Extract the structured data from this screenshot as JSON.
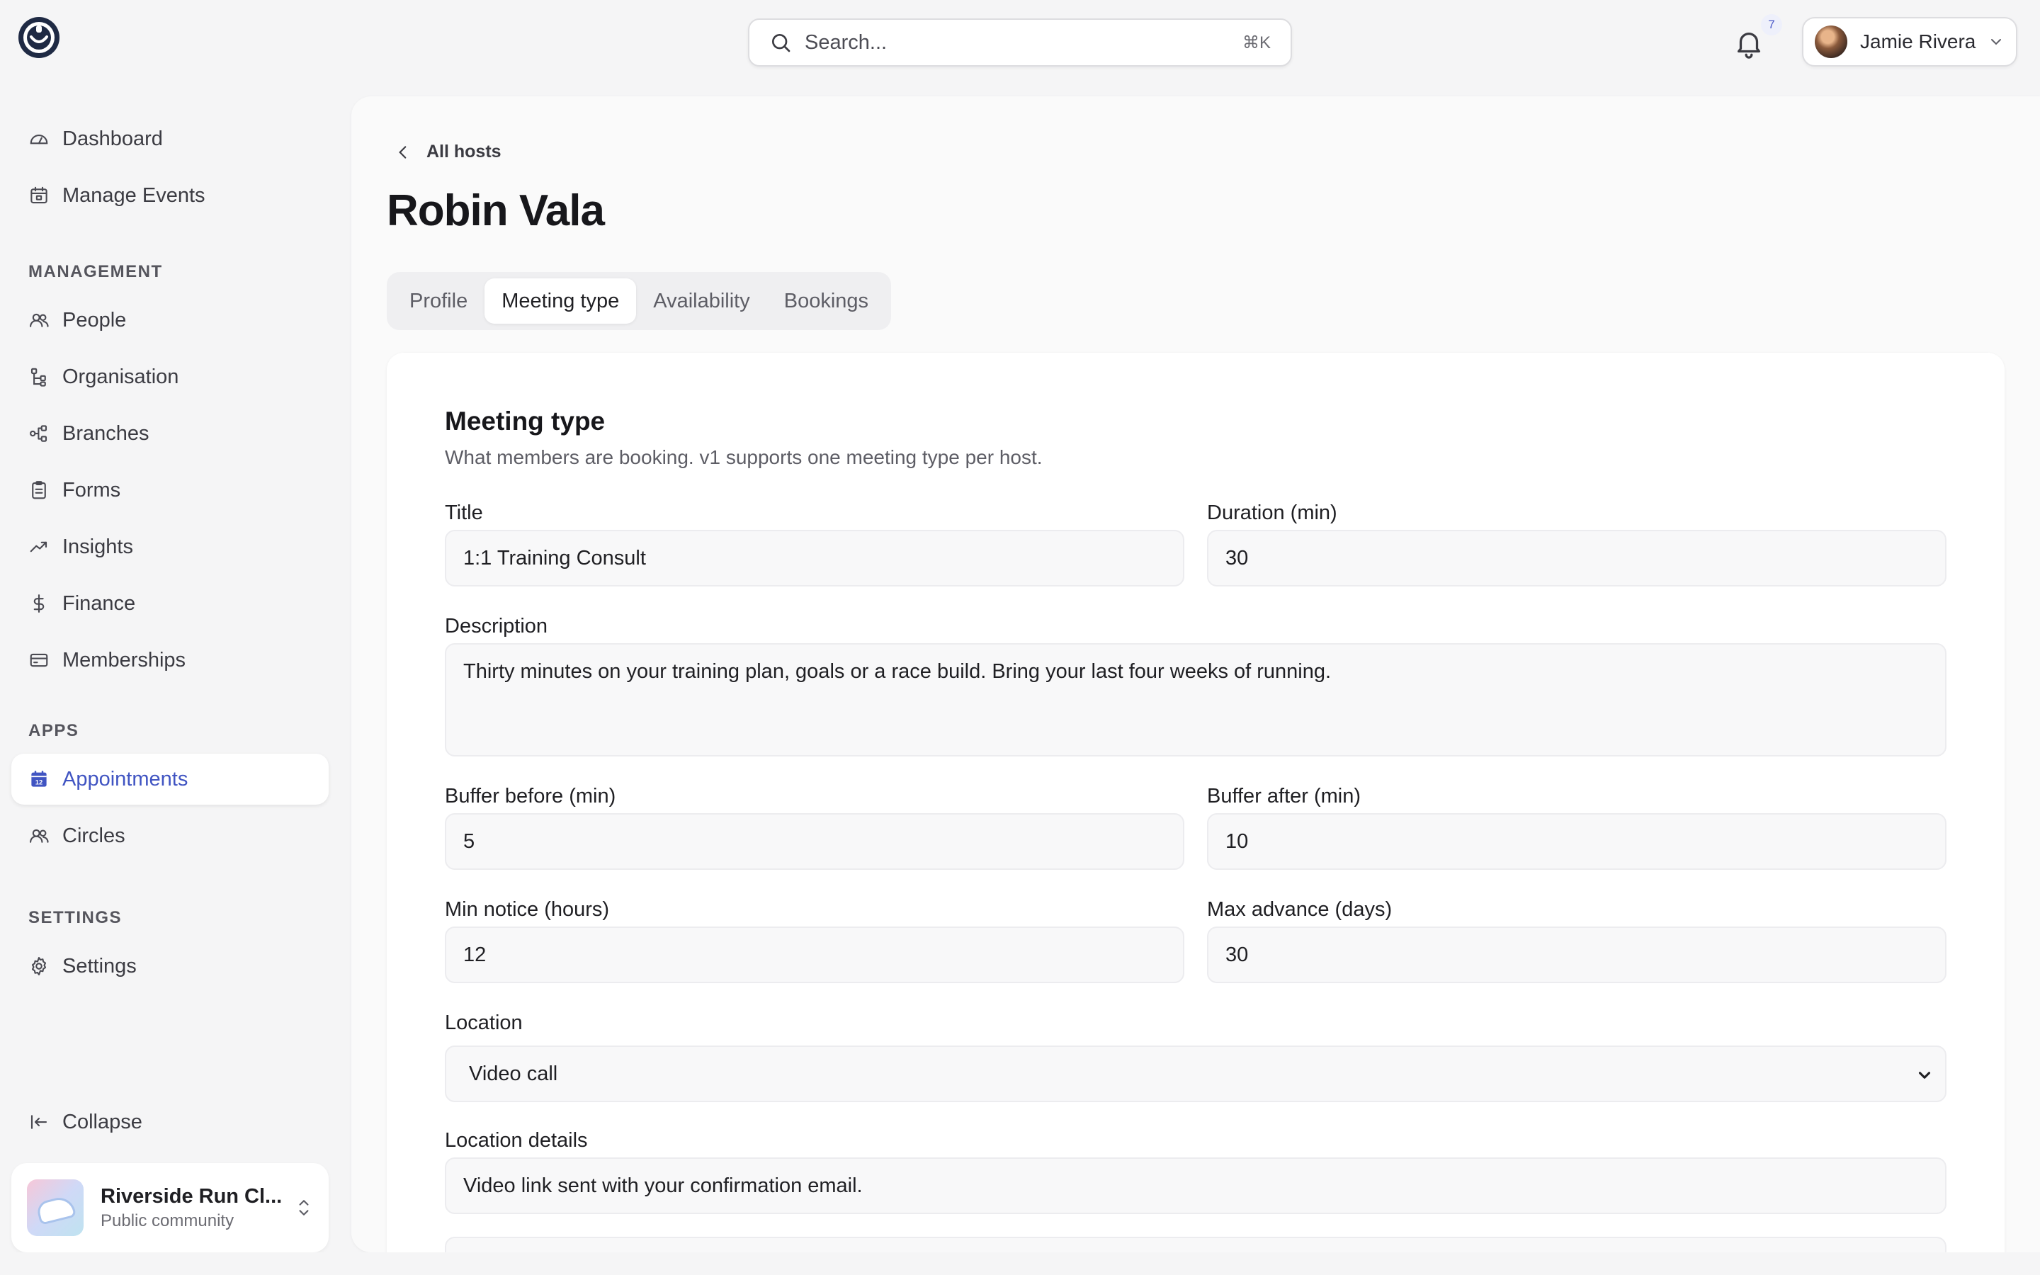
{
  "header": {
    "search_placeholder": "Search...",
    "search_shortcut": "⌘K",
    "notifications_count": "7",
    "user_name": "Jamie Rivera"
  },
  "sidebar": {
    "top_items": [
      {
        "label": "Dashboard",
        "icon": "gauge-icon"
      },
      {
        "label": "Manage Events",
        "icon": "calendar-icon"
      }
    ],
    "sections": [
      {
        "title": "MANAGEMENT"
      },
      {
        "title": "APPS"
      },
      {
        "title": "SETTINGS"
      }
    ],
    "management_items": [
      {
        "label": "People",
        "icon": "people-icon"
      },
      {
        "label": "Organisation",
        "icon": "organisation-icon"
      },
      {
        "label": "Branches",
        "icon": "branches-icon"
      },
      {
        "label": "Forms",
        "icon": "clipboard-icon"
      },
      {
        "label": "Insights",
        "icon": "trend-up-icon"
      },
      {
        "label": "Finance",
        "icon": "dollar-icon"
      },
      {
        "label": "Memberships",
        "icon": "card-icon"
      }
    ],
    "apps_items": [
      {
        "label": "Appointments",
        "icon": "calendar-12-icon",
        "active": true
      },
      {
        "label": "Circles",
        "icon": "people-icon"
      }
    ],
    "settings_items": [
      {
        "label": "Settings",
        "icon": "gear-icon"
      }
    ],
    "collapse_label": "Collapse",
    "community": {
      "name": "Riverside Run Cl...",
      "subtitle": "Public community"
    }
  },
  "main": {
    "back_label": "All hosts",
    "page_title": "Robin Vala",
    "tabs": [
      {
        "label": "Profile"
      },
      {
        "label": "Meeting type",
        "active": true
      },
      {
        "label": "Availability"
      },
      {
        "label": "Bookings"
      }
    ],
    "card": {
      "title": "Meeting type",
      "description": "What members are booking. v1 supports one meeting type per host.",
      "fields": {
        "title": {
          "label": "Title",
          "value": "1:1 Training Consult"
        },
        "duration": {
          "label": "Duration (min)",
          "value": "30"
        },
        "description": {
          "label": "Description",
          "value": "Thirty minutes on your training plan, goals or a race build. Bring your last four weeks of running."
        },
        "buffer_before": {
          "label": "Buffer before (min)",
          "value": "5"
        },
        "buffer_after": {
          "label": "Buffer after (min)",
          "value": "10"
        },
        "min_notice": {
          "label": "Min notice (hours)",
          "value": "12"
        },
        "max_advance": {
          "label": "Max advance (days)",
          "value": "30"
        },
        "location": {
          "label": "Location",
          "value": "Video call"
        },
        "location_details": {
          "label": "Location details",
          "value": "Video link sent with your confirmation email."
        }
      }
    }
  },
  "colors": {
    "accent": "#4054c2",
    "background": "#f5f5f6",
    "panel": "#fafafa",
    "card": "#ffffff"
  }
}
